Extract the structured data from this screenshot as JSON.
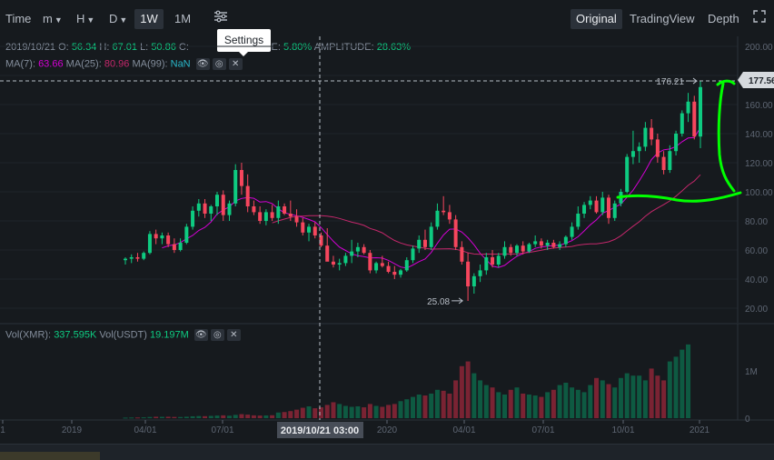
{
  "toolbar": {
    "time_label": "Time",
    "m_label": "m",
    "h_label": "H",
    "d_label": "D",
    "w_label": "1W",
    "mo_label": "1M",
    "original_label": "Original",
    "tradingview_label": "TradingView",
    "depth_label": "Depth"
  },
  "ohlc": {
    "date": "2019/10/21",
    "o_label": "O:",
    "o_value": "56.34",
    "h_label": "H:",
    "h_value": "67.01",
    "l_label": "L:",
    "l_value": "50.86",
    "c_label": "C:",
    "change_label": "NGE:",
    "change_value": "5.80%",
    "amplitude_label": "AMPLITUDE:",
    "amplitude_value": "28.63%"
  },
  "ma": {
    "ma7_label": "MA(7):",
    "ma7_value": "63.66",
    "ma25_label": "MA(25):",
    "ma25_value": "80.96",
    "ma99_label": "MA(99):",
    "ma99_value": "NaN"
  },
  "tooltip": {
    "text": "Settings"
  },
  "volume": {
    "xmr_label": "Vol(XMR):",
    "xmr_value": "337.595K",
    "usdt_label": "Vol(USDT)",
    "usdt_value": "19.197M"
  },
  "crosshair": {
    "time_label": "2019/10/21 03:00"
  },
  "colors": {
    "up": "#0ecb81",
    "down": "#f6465d",
    "ma7": "#d400d4",
    "ma25": "#c4276b",
    "annotation": "#00ff00"
  },
  "icons": [
    "eye-icon",
    "settings-circle-icon",
    "close-icon",
    "settings-sliders-icon",
    "fullscreen-icon"
  ],
  "chart_data": [
    {
      "type": "candlestick",
      "title": "",
      "xlabel": "",
      "ylabel": "",
      "x_ticks": [
        "1",
        "2019",
        "04/01",
        "07/01",
        "2020",
        "04/01",
        "07/01",
        "10/01",
        "2021"
      ],
      "y_ticks": [
        "20.00",
        "40.00",
        "60.00",
        "80.00",
        "100.00",
        "120.00",
        "140.00",
        "160.00",
        "180.00",
        "200.00"
      ],
      "ylim": [
        12,
        205
      ],
      "current_price_label": "177.56",
      "high_marker_label": "176.21",
      "low_marker_label": "25.08",
      "candles": [
        {
          "o": 53,
          "h": 55,
          "l": 50,
          "c": 54
        },
        {
          "o": 54,
          "h": 57,
          "l": 51,
          "c": 55
        },
        {
          "o": 55,
          "h": 58,
          "l": 52,
          "c": 54
        },
        {
          "o": 54,
          "h": 59,
          "l": 53,
          "c": 58
        },
        {
          "o": 58,
          "h": 73,
          "l": 57,
          "c": 71
        },
        {
          "o": 71,
          "h": 74,
          "l": 64,
          "c": 68
        },
        {
          "o": 68,
          "h": 72,
          "l": 64,
          "c": 70
        },
        {
          "o": 70,
          "h": 72,
          "l": 62,
          "c": 64
        },
        {
          "o": 64,
          "h": 68,
          "l": 58,
          "c": 60
        },
        {
          "o": 60,
          "h": 68,
          "l": 59,
          "c": 65
        },
        {
          "o": 65,
          "h": 78,
          "l": 64,
          "c": 76
        },
        {
          "o": 76,
          "h": 90,
          "l": 74,
          "c": 87
        },
        {
          "o": 87,
          "h": 95,
          "l": 83,
          "c": 92
        },
        {
          "o": 92,
          "h": 95,
          "l": 82,
          "c": 85
        },
        {
          "o": 85,
          "h": 91,
          "l": 80,
          "c": 90
        },
        {
          "o": 90,
          "h": 100,
          "l": 84,
          "c": 98
        },
        {
          "o": 98,
          "h": 101,
          "l": 80,
          "c": 84
        },
        {
          "o": 84,
          "h": 94,
          "l": 80,
          "c": 92
        },
        {
          "o": 92,
          "h": 119,
          "l": 90,
          "c": 115
        },
        {
          "o": 115,
          "h": 120,
          "l": 98,
          "c": 104
        },
        {
          "o": 104,
          "h": 112,
          "l": 86,
          "c": 90
        },
        {
          "o": 90,
          "h": 94,
          "l": 84,
          "c": 86
        },
        {
          "o": 86,
          "h": 90,
          "l": 78,
          "c": 80
        },
        {
          "o": 80,
          "h": 88,
          "l": 77,
          "c": 86
        },
        {
          "o": 86,
          "h": 91,
          "l": 80,
          "c": 82
        },
        {
          "o": 82,
          "h": 94,
          "l": 78,
          "c": 90
        },
        {
          "o": 90,
          "h": 92,
          "l": 84,
          "c": 85
        },
        {
          "o": 85,
          "h": 94,
          "l": 80,
          "c": 83
        },
        {
          "o": 83,
          "h": 88,
          "l": 76,
          "c": 79
        },
        {
          "o": 79,
          "h": 82,
          "l": 70,
          "c": 72
        },
        {
          "o": 72,
          "h": 78,
          "l": 66,
          "c": 76
        },
        {
          "o": 76,
          "h": 79,
          "l": 68,
          "c": 70
        },
        {
          "o": 70,
          "h": 72,
          "l": 62,
          "c": 63
        },
        {
          "o": 63,
          "h": 75,
          "l": 55,
          "c": 52
        },
        {
          "o": 52,
          "h": 56,
          "l": 48,
          "c": 50
        },
        {
          "o": 50,
          "h": 54,
          "l": 46,
          "c": 51
        },
        {
          "o": 51,
          "h": 58,
          "l": 49,
          "c": 56
        },
        {
          "o": 56,
          "h": 67,
          "l": 51,
          "c": 59
        },
        {
          "o": 59,
          "h": 65,
          "l": 55,
          "c": 62
        },
        {
          "o": 62,
          "h": 64,
          "l": 57,
          "c": 58
        },
        {
          "o": 58,
          "h": 60,
          "l": 44,
          "c": 46
        },
        {
          "o": 46,
          "h": 52,
          "l": 44,
          "c": 51
        },
        {
          "o": 51,
          "h": 56,
          "l": 48,
          "c": 49
        },
        {
          "o": 49,
          "h": 52,
          "l": 44,
          "c": 45
        },
        {
          "o": 45,
          "h": 49,
          "l": 40,
          "c": 43
        },
        {
          "o": 43,
          "h": 47,
          "l": 41,
          "c": 46
        },
        {
          "o": 46,
          "h": 55,
          "l": 45,
          "c": 53
        },
        {
          "o": 53,
          "h": 63,
          "l": 51,
          "c": 61
        },
        {
          "o": 61,
          "h": 70,
          "l": 58,
          "c": 67
        },
        {
          "o": 67,
          "h": 74,
          "l": 60,
          "c": 62
        },
        {
          "o": 62,
          "h": 79,
          "l": 60,
          "c": 76
        },
        {
          "o": 76,
          "h": 92,
          "l": 74,
          "c": 87
        },
        {
          "o": 87,
          "h": 97,
          "l": 84,
          "c": 86
        },
        {
          "o": 86,
          "h": 91,
          "l": 78,
          "c": 81
        },
        {
          "o": 81,
          "h": 84,
          "l": 60,
          "c": 62
        },
        {
          "o": 62,
          "h": 66,
          "l": 50,
          "c": 52
        },
        {
          "o": 52,
          "h": 58,
          "l": 25,
          "c": 35
        },
        {
          "o": 35,
          "h": 44,
          "l": 30,
          "c": 42
        },
        {
          "o": 42,
          "h": 50,
          "l": 38,
          "c": 46
        },
        {
          "o": 46,
          "h": 58,
          "l": 43,
          "c": 55
        },
        {
          "o": 55,
          "h": 60,
          "l": 48,
          "c": 50
        },
        {
          "o": 50,
          "h": 58,
          "l": 48,
          "c": 56
        },
        {
          "o": 56,
          "h": 66,
          "l": 54,
          "c": 62
        },
        {
          "o": 62,
          "h": 64,
          "l": 56,
          "c": 58
        },
        {
          "o": 58,
          "h": 64,
          "l": 56,
          "c": 63
        },
        {
          "o": 63,
          "h": 66,
          "l": 57,
          "c": 59
        },
        {
          "o": 59,
          "h": 65,
          "l": 58,
          "c": 64
        },
        {
          "o": 64,
          "h": 70,
          "l": 62,
          "c": 66
        },
        {
          "o": 66,
          "h": 68,
          "l": 61,
          "c": 63
        },
        {
          "o": 63,
          "h": 67,
          "l": 60,
          "c": 65
        },
        {
          "o": 65,
          "h": 67,
          "l": 61,
          "c": 62
        },
        {
          "o": 62,
          "h": 66,
          "l": 60,
          "c": 64
        },
        {
          "o": 64,
          "h": 70,
          "l": 62,
          "c": 69
        },
        {
          "o": 69,
          "h": 79,
          "l": 67,
          "c": 76
        },
        {
          "o": 76,
          "h": 90,
          "l": 74,
          "c": 85
        },
        {
          "o": 85,
          "h": 93,
          "l": 82,
          "c": 91
        },
        {
          "o": 91,
          "h": 97,
          "l": 88,
          "c": 94
        },
        {
          "o": 94,
          "h": 97,
          "l": 85,
          "c": 86
        },
        {
          "o": 86,
          "h": 100,
          "l": 84,
          "c": 96
        },
        {
          "o": 96,
          "h": 98,
          "l": 78,
          "c": 82
        },
        {
          "o": 82,
          "h": 94,
          "l": 80,
          "c": 92
        },
        {
          "o": 92,
          "h": 102,
          "l": 90,
          "c": 100
        },
        {
          "o": 100,
          "h": 126,
          "l": 99,
          "c": 124
        },
        {
          "o": 124,
          "h": 142,
          "l": 119,
          "c": 128
        },
        {
          "o": 128,
          "h": 134,
          "l": 120,
          "c": 131
        },
        {
          "o": 131,
          "h": 148,
          "l": 128,
          "c": 144
        },
        {
          "o": 144,
          "h": 150,
          "l": 132,
          "c": 136
        },
        {
          "o": 136,
          "h": 140,
          "l": 120,
          "c": 124
        },
        {
          "o": 124,
          "h": 128,
          "l": 112,
          "c": 115
        },
        {
          "o": 115,
          "h": 132,
          "l": 113,
          "c": 128
        },
        {
          "o": 128,
          "h": 142,
          "l": 125,
          "c": 140
        },
        {
          "o": 140,
          "h": 156,
          "l": 138,
          "c": 154
        },
        {
          "o": 154,
          "h": 168,
          "l": 148,
          "c": 162
        },
        {
          "o": 162,
          "h": 166,
          "l": 136,
          "c": 138
        },
        {
          "o": 138,
          "h": 176.21,
          "l": 130,
          "c": 172
        }
      ]
    },
    {
      "type": "bar",
      "title": "",
      "series_name": "Vol(XMR)",
      "y_ticks": [
        "0",
        "1M"
      ],
      "ylim": [
        0,
        1600000
      ],
      "values": [
        12000,
        14000,
        15000,
        18000,
        25000,
        30000,
        28000,
        30000,
        26000,
        24000,
        30000,
        40000,
        45000,
        42000,
        48000,
        55000,
        60000,
        52000,
        70000,
        85000,
        75000,
        60000,
        55000,
        58000,
        62000,
        120000,
        130000,
        150000,
        180000,
        220000,
        250000,
        210000,
        230000,
        280000,
        337595,
        300000,
        260000,
        240000,
        250000,
        230000,
        300000,
        260000,
        240000,
        280000,
        300000,
        360000,
        400000,
        450000,
        500000,
        480000,
        520000,
        600000,
        580000,
        520000,
        800000,
        1100000,
        1200000,
        950000,
        800000,
        700000,
        650000,
        550000,
        500000,
        600000,
        650000,
        520000,
        500000,
        480000,
        450000,
        550000,
        600000,
        700000,
        750000,
        650000,
        600000,
        550000,
        700000,
        850000,
        800000,
        720000,
        650000,
        850000,
        950000,
        900000,
        900000,
        800000,
        1050000,
        900000,
        800000,
        1200000,
        1300000,
        1450000,
        1560000
      ]
    }
  ]
}
